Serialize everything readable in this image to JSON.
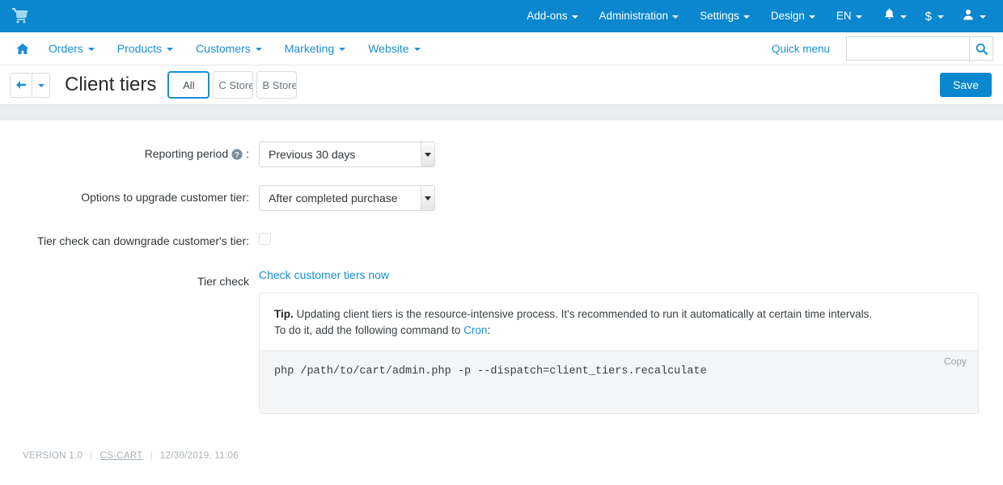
{
  "topbar": {
    "logo_icon": "shopping-cart-icon",
    "menu": [
      {
        "label": "Add-ons",
        "icon": "chevron-down-icon"
      },
      {
        "label": "Administration",
        "icon": "chevron-down-icon"
      },
      {
        "label": "Settings",
        "icon": "chevron-down-icon"
      },
      {
        "label": "Design",
        "icon": "chevron-down-icon"
      },
      {
        "label": "EN",
        "icon": "chevron-down-icon"
      }
    ],
    "icons": [
      {
        "name": "notifications-bell-icon",
        "glyph": "ὑ4"
      },
      {
        "name": "currency-dollar-icon",
        "glyph": "$"
      },
      {
        "name": "user-account-icon",
        "glyph": "user"
      }
    ]
  },
  "navbar": {
    "home_icon": "home-icon",
    "items": [
      {
        "label": "Orders"
      },
      {
        "label": "Products"
      },
      {
        "label": "Customers"
      },
      {
        "label": "Marketing"
      },
      {
        "label": "Website"
      }
    ],
    "quick_menu_label": "Quick menu",
    "search": {
      "value": "",
      "placeholder": "",
      "icon": "search-icon"
    }
  },
  "titlebar": {
    "back_icon": "arrow-left-icon",
    "back_caret_icon": "chevron-down-icon",
    "title": "Client tiers",
    "tabs": [
      {
        "label": "All",
        "active": true
      },
      {
        "label": "C Store",
        "active": false
      },
      {
        "label": "B Store",
        "active": false
      }
    ],
    "save_label": "Save"
  },
  "form": {
    "reporting_period": {
      "label": "Reporting period",
      "label_suffix": ":",
      "help_icon": "question-mark-help-icon",
      "value": "Previous 30 days"
    },
    "upgrade_options": {
      "label": "Options to upgrade customer tier:",
      "value": "After completed purchase"
    },
    "downgrade": {
      "label": "Tier check can downgrade customer's tier:",
      "checked": false
    },
    "tier_check": {
      "label": "Tier check",
      "link_label": "Check customer tiers now"
    }
  },
  "tip": {
    "prefix": "Tip.",
    "line1": " Updating client tiers is the resource-intensive process. It's recommended to run it automatically at certain time intervals.",
    "line2_before": "To do it, add the following command to ",
    "line2_link": "Cron",
    "line2_after": ":",
    "code": "php /path/to/cart/admin.php -p --dispatch=client_tiers.recalculate",
    "copy_label": "Copy"
  },
  "footer": {
    "version": "VERSION 1.0",
    "brand": "CS-CART",
    "timestamp": "12/30/2019, 11:06"
  },
  "colors": {
    "brand_blue": "#0a87ce",
    "link_blue": "#1a8fd4",
    "strip_gray": "#eaeef1",
    "code_bg": "#f4f5f6"
  }
}
